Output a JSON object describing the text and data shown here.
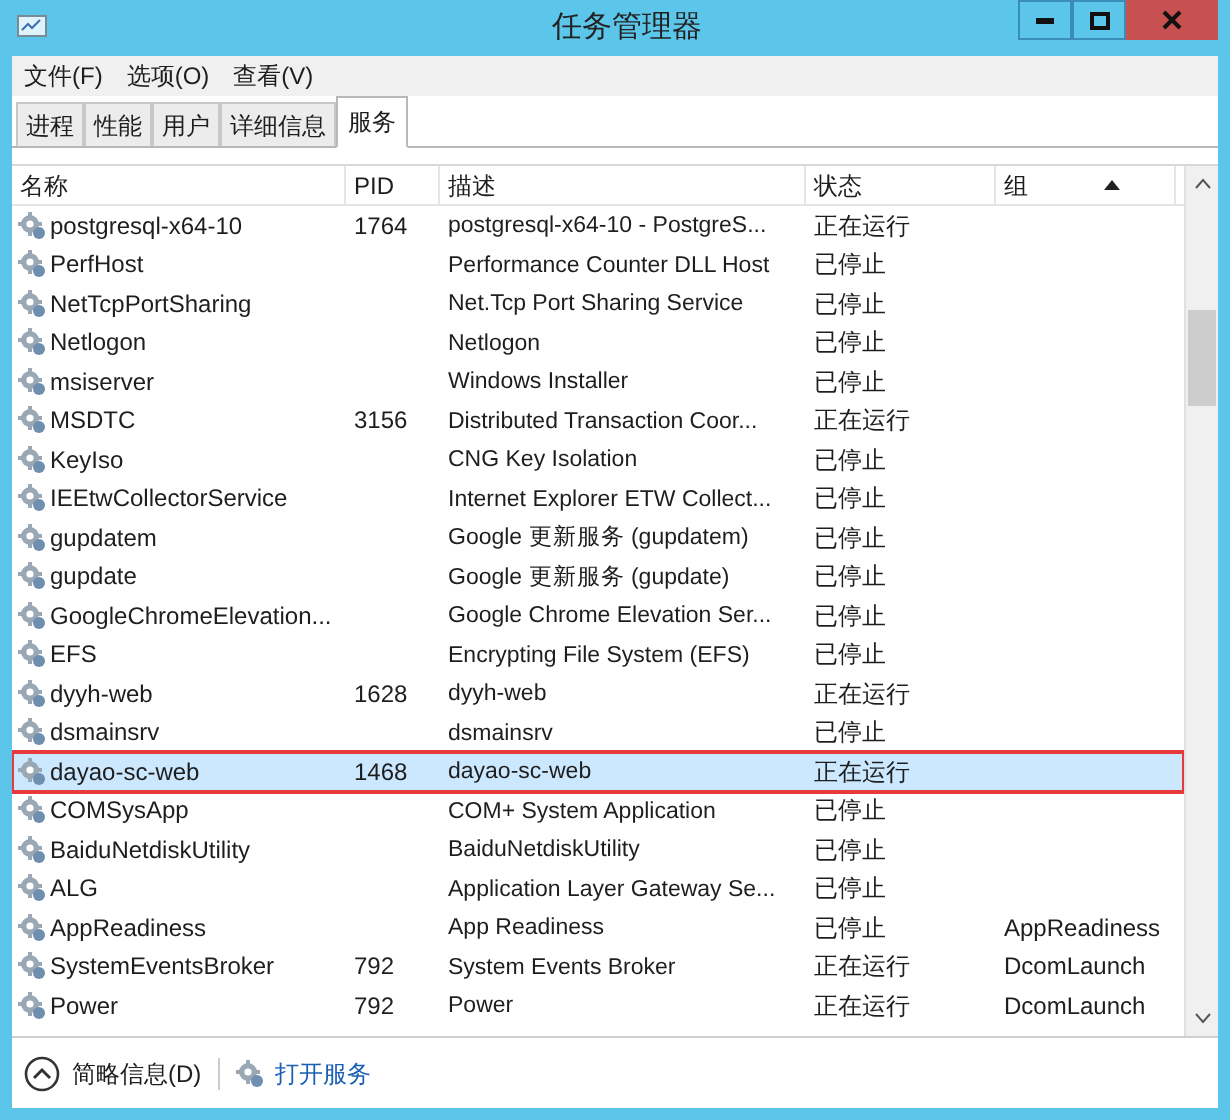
{
  "window": {
    "title": "任务管理器"
  },
  "menu": [
    "文件(F)",
    "选项(O)",
    "查看(V)"
  ],
  "tabs": [
    {
      "label": "进程",
      "selected": false
    },
    {
      "label": "性能",
      "selected": false
    },
    {
      "label": "用户",
      "selected": false
    },
    {
      "label": "详细信息",
      "selected": false
    },
    {
      "label": "服务",
      "selected": true
    }
  ],
  "table": {
    "columns": [
      "名称",
      "PID",
      "描述",
      "状态",
      "组"
    ],
    "rows": [
      {
        "name": "postgresql-x64-10",
        "pid": "1764",
        "description": "postgresql-x64-10 - PostgreS...",
        "status": "正在运行",
        "selected": false
      },
      {
        "name": "PerfHost",
        "description": "Performance Counter DLL Host",
        "status": "已停止",
        "selected": false
      },
      {
        "name": "NetTcpPortSharing",
        "description": "Net.Tcp Port Sharing Service",
        "status": "已停止",
        "selected": false
      },
      {
        "name": "Netlogon",
        "description": "Netlogon",
        "status": "已停止",
        "selected": false
      },
      {
        "name": "msiserver",
        "description": "Windows Installer",
        "status": "已停止",
        "selected": false
      },
      {
        "name": "MSDTC",
        "pid": "3156",
        "description": "Distributed Transaction Coor...",
        "status": "正在运行",
        "selected": false
      },
      {
        "name": "KeyIso",
        "description": "CNG Key Isolation",
        "status": "已停止",
        "selected": false
      },
      {
        "name": "IEEtwCollectorService",
        "description": "Internet Explorer ETW Collect...",
        "status": "已停止",
        "selected": false
      },
      {
        "name": "gupdatem",
        "description": "Google 更新服务 (gupdatem)",
        "status": "已停止",
        "selected": false
      },
      {
        "name": "gupdate",
        "description": "Google 更新服务 (gupdate)",
        "status": "已停止",
        "selected": false
      },
      {
        "name": "GoogleChromeElevation...",
        "description": "Google Chrome Elevation Ser...",
        "status": "已停止",
        "selected": false
      },
      {
        "name": "EFS",
        "description": "Encrypting File System (EFS)",
        "status": "已停止",
        "selected": false
      },
      {
        "name": "dyyh-web",
        "pid": "1628",
        "description": "dyyh-web",
        "status": "正在运行",
        "selected": false
      },
      {
        "name": "dsmainsrv",
        "description": "dsmainsrv",
        "status": "已停止",
        "selected": false
      },
      {
        "name": "dayao-sc-web",
        "pid": "1468",
        "description": "dayao-sc-web",
        "status": "正在运行",
        "selected": true
      },
      {
        "name": "COMSysApp",
        "description": "COM+ System Application",
        "status": "已停止",
        "selected": false
      },
      {
        "name": "BaiduNetdiskUtility",
        "description": "BaiduNetdiskUtility",
        "status": "已停止",
        "selected": false
      },
      {
        "name": "ALG",
        "description": "Application Layer Gateway Se...",
        "status": "已停止",
        "selected": false
      },
      {
        "name": "AppReadiness",
        "description": "App Readiness",
        "status": "已停止",
        "group": "AppReadiness",
        "selected": false
      },
      {
        "name": "SystemEventsBroker",
        "pid": "792",
        "description": "System Events Broker",
        "status": "正在运行",
        "group": "DcomLaunch",
        "selected": false
      },
      {
        "name": "Power",
        "pid": "792",
        "description": "Power",
        "status": "正在运行",
        "group": "DcomLaunch",
        "selected": false
      }
    ]
  },
  "footer": {
    "details_link": "简略信息(D)",
    "open_services_link": "打开服务"
  }
}
